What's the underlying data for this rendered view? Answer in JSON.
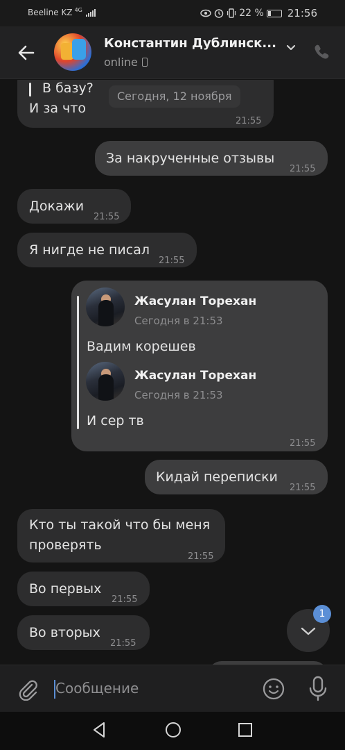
{
  "status_bar": {
    "carrier": "Beeline KZ",
    "network": "4G",
    "battery": "22 %",
    "time": "21:56"
  },
  "header": {
    "title": "Константин Дублинск...",
    "status": "online",
    "icons": [
      "back-arrow-icon",
      "chevron-down-icon",
      "phone-icon"
    ]
  },
  "messages": {
    "m0": {
      "lines": [
        "В базу?",
        "И за что"
      ],
      "time": "21:55"
    },
    "date_pill": "Сегодня, 12 ноября",
    "m1": {
      "text": "За накрученные отзывы",
      "time": "21:55"
    },
    "m2": {
      "text": "Докажи",
      "time": "21:55"
    },
    "m3": {
      "text": "Я нигде не писал",
      "time": "21:55"
    },
    "forwarded": {
      "items": [
        {
          "author": "Жасулан Торехан",
          "time": "Сегодня в 21:53",
          "text": "Вадим корешев"
        },
        {
          "author": "Жасулан Торехан",
          "time": "Сегодня в 21:53",
          "text": "И сер тв"
        }
      ],
      "time": "21:55"
    },
    "m4": {
      "text": "Кидай переписки",
      "time": "21:55"
    },
    "m5": {
      "lines": [
        "Кто ты такой что бы меня",
        "проверять"
      ],
      "time": "21:55"
    },
    "m6": {
      "text": "Во первых",
      "time": "21:55"
    },
    "m7": {
      "text": "Во вторых",
      "time": "21:55"
    }
  },
  "scroll_button": {
    "badge": "1"
  },
  "composer": {
    "placeholder": "Сообщение"
  },
  "colors": {
    "accent": "#5b8fd6",
    "incoming": "#2d2d2e",
    "outgoing": "#3d3d3e",
    "background": "#141414"
  }
}
